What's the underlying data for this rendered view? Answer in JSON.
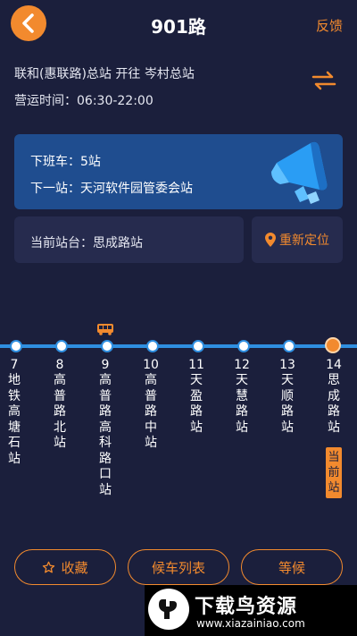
{
  "header": {
    "title": "901路",
    "feedback_label": "反馈"
  },
  "route": {
    "description": "联和(惠联路)总站 开往 岑村总站",
    "hours": "营运时间：06:30-22:00"
  },
  "card": {
    "off_duty_bus": "下班车：5站",
    "next_stop": "下一站：天河软件园管委会站"
  },
  "station": {
    "current": "当前站台：思成路站",
    "relocate_label": "重新定位"
  },
  "stops": [
    {
      "num": "7",
      "name": "地铁高塘石站"
    },
    {
      "num": "8",
      "name": "高普路北站"
    },
    {
      "num": "9",
      "name": "高普路高科路口站"
    },
    {
      "num": "10",
      "name": "高普路中站"
    },
    {
      "num": "11",
      "name": "天盈路站"
    },
    {
      "num": "12",
      "name": "天慧路站"
    },
    {
      "num": "13",
      "name": "天顺路站"
    },
    {
      "num": "14",
      "name": "思成路站"
    }
  ],
  "current_badge": "当前站",
  "buttons": {
    "favorite": "收藏",
    "bus_list": "候车列表",
    "wait": "等候"
  },
  "watermark": {
    "title": "下载鸟资源",
    "url": "www.xiazainiao.com"
  },
  "icons": {
    "back": "back-arrow-icon",
    "swap": "swap-direction-icon",
    "megaphone": "megaphone-icon",
    "location": "location-pin-icon",
    "bus": "bus-icon",
    "star": "star-outline-icon"
  },
  "colors": {
    "background": "#1b1f3c",
    "accent": "#f28a2e",
    "route": "#2f8fe0",
    "card": "#1f4d8f"
  }
}
